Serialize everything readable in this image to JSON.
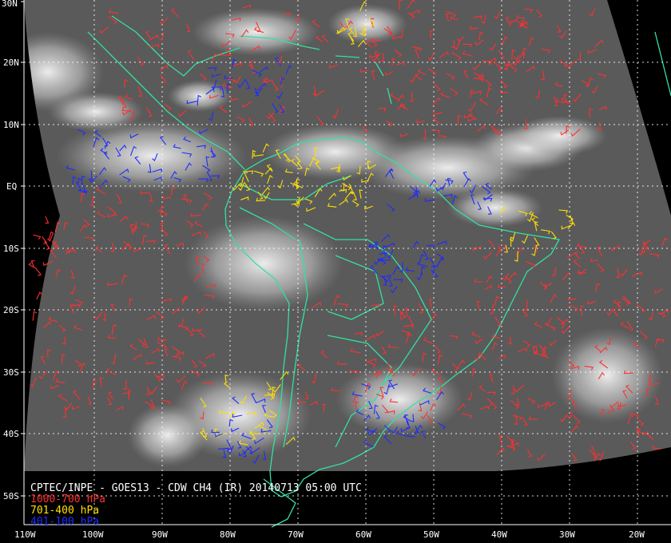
{
  "product": {
    "title": "CPTEC/INPE - GOES13 - CDW CH4 (IR) 20140713 05:00 UTC"
  },
  "legend": [
    {
      "label": "1000-700 hPa",
      "color": "#ff3030"
    },
    {
      "label": "701-400 hPa",
      "color": "#ffe000"
    },
    {
      "label": "401-100 hPa",
      "color": "#1e2cff"
    }
  ],
  "axes": {
    "lat_labels": [
      "30N",
      "20N",
      "10N",
      "EQ",
      "10S",
      "20S",
      "30S",
      "40S",
      "50S"
    ],
    "lon_labels": [
      "110W",
      "100W",
      "90W",
      "80W",
      "70W",
      "60W",
      "50W",
      "40W",
      "30W",
      "20W"
    ]
  },
  "colors": {
    "coast": "#33e0a0",
    "grid": "#ffffff",
    "background": "#000000"
  }
}
